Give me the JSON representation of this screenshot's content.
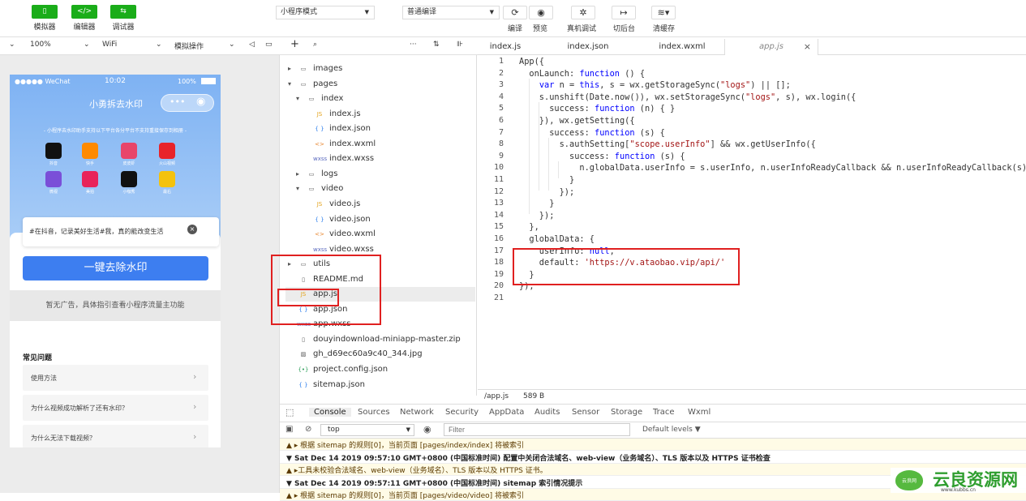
{
  "toolbar": {
    "simulator": {
      "label": "模拟器",
      "icon": "phone-icon"
    },
    "editor": {
      "label": "编辑器",
      "icon": "code-icon"
    },
    "debugger": {
      "label": "调试器",
      "icon": "debug-icon"
    },
    "mode_select": "小程序模式",
    "compile_select": "普通编译",
    "compile": "编译",
    "preview": "预览",
    "remote_debug": "真机调试",
    "background": "切后台",
    "clear_cache": "清缓存",
    "accent": "#1aad19"
  },
  "sim_bar": {
    "zoom": "100%",
    "network": "WiFi",
    "operation": "模拟操作"
  },
  "phone": {
    "status_carrier": "●●●●● WeChat",
    "status_time": "10:02",
    "status_battery": "100%",
    "title": "小勇拆去水印",
    "subtitle": "- 小程序去水印助手支持以下平台各分平台不支持重接保存到相册 -",
    "apps": [
      {
        "name": "抖音",
        "color": "#111111"
      },
      {
        "name": "快手",
        "color": "#ff8a00"
      },
      {
        "name": "皮皮虾",
        "color": "#e8456a"
      },
      {
        "name": "火山视频",
        "color": "#e8232a"
      },
      {
        "name": "微视",
        "color": "#7a4fd8"
      },
      {
        "name": "美拍",
        "color": "#e8235a"
      },
      {
        "name": "小咖秀",
        "color": "#111111"
      },
      {
        "name": "最右",
        "color": "#f4c20d"
      }
    ],
    "input_text": "#在抖音，记录美好生活#我，真的能改变生活",
    "main_button": "一键去除水印",
    "ad_text": "暂无广告，具体指引查看小程序流量主功能",
    "faq_title": "常见问题",
    "faq_items": [
      "使用方法",
      "为什么视频成功解析了还有水印？",
      "为什么无法下载视频？"
    ]
  },
  "explorer": {
    "items": [
      "images",
      "pages",
      "index",
      "index.js",
      "index.json",
      "index.wxml",
      "index.wxss",
      "logs",
      "video",
      "video.js",
      "video.json",
      "video.wxml",
      "video.wxss",
      "utils",
      "README.md",
      "app.js",
      "app.json",
      "app.wxss",
      "douyindownload-miniapp-master.zip",
      "gh_d69ec60a9c40_344.jpg",
      "project.config.json",
      "sitemap.json"
    ]
  },
  "editor": {
    "tabs": [
      "index.js",
      "index.json",
      "index.wxml",
      "app.js"
    ],
    "code": [
      "App({",
      "  onLaunch: function () {",
      "    var n = this, s = wx.getStorageSync(\"logs\") || [];",
      "    s.unshift(Date.now()), wx.setStorageSync(\"logs\", s), wx.login({",
      "      success: function (n) { }",
      "    }), wx.getSetting({",
      "      success: function (s) {",
      "        s.authSetting[\"scope.userInfo\"] && wx.getUserInfo({",
      "          success: function (s) {",
      "            n.globalData.userInfo = s.userInfo, n.userInfoReadyCallback && n.userInfoReadyCallback(s);",
      "          }",
      "        });",
      "      }",
      "    });",
      "  },",
      "  globalData: {",
      "    userInfo: null,",
      "    default: 'https://v.ataobao.vip/api/'",
      "  }",
      "});",
      ""
    ],
    "status_file": "/app.js",
    "status_size": "589 B"
  },
  "console": {
    "tabs": [
      "Console",
      "Sources",
      "Network",
      "Security",
      "AppData",
      "Audits",
      "Sensor",
      "Storage",
      "Trace",
      "Wxml"
    ],
    "context": "top",
    "filter_placeholder": "Filter",
    "levels": "Default levels ▼",
    "lines": [
      "▲  ▸ 根据 sitemap 的规则[0]，当前页面 [pages/index/index] 将被索引",
      "▼ Sat Dec 14 2019 09:57:10 GMT+0800 (中国标准时间) 配置中关闭合法域名、web-view（业务域名）、TLS 版本以及 HTTPS 证书检查",
      "▲ ▸工具未校验合法域名、web-view（业务域名）、TLS 版本以及 HTTPS 证书。",
      "▼ Sat Dec 14 2019 09:57:11 GMT+0800 (中国标准时间) sitemap 索引情况提示",
      "▲  ▸ 根据 sitemap 的规则[0]，当前页面 [pages/video/video] 将被索引"
    ]
  },
  "watermark": {
    "main": "云良资源网",
    "left": "云良网",
    "url": "www.kubbs.cn"
  }
}
